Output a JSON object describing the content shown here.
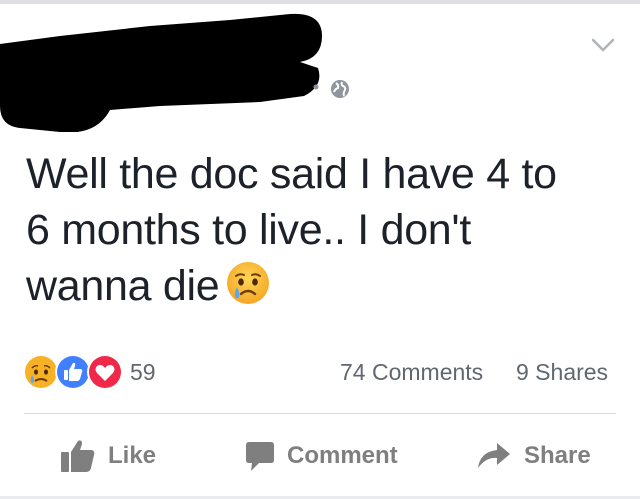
{
  "post": {
    "text_lines": [
      "Well the doc said I have 4 to",
      "6 months to live.. I don't",
      "wanna die"
    ],
    "emoji": "crying-face-emoji"
  },
  "reactions": {
    "icons": [
      "sad-reaction-icon",
      "like-reaction-icon",
      "love-reaction-icon"
    ],
    "count": "59"
  },
  "stats": {
    "comments": "74 Comments",
    "shares": "9 Shares"
  },
  "actions": {
    "like": "Like",
    "comment": "Comment",
    "share": "Share"
  },
  "colors": {
    "like_blue": "#4080ff",
    "love_red": "#f0284a",
    "emoji_yellow": "#f7b125",
    "muted_text": "#616770",
    "action_gray": "#7f7f7f"
  }
}
